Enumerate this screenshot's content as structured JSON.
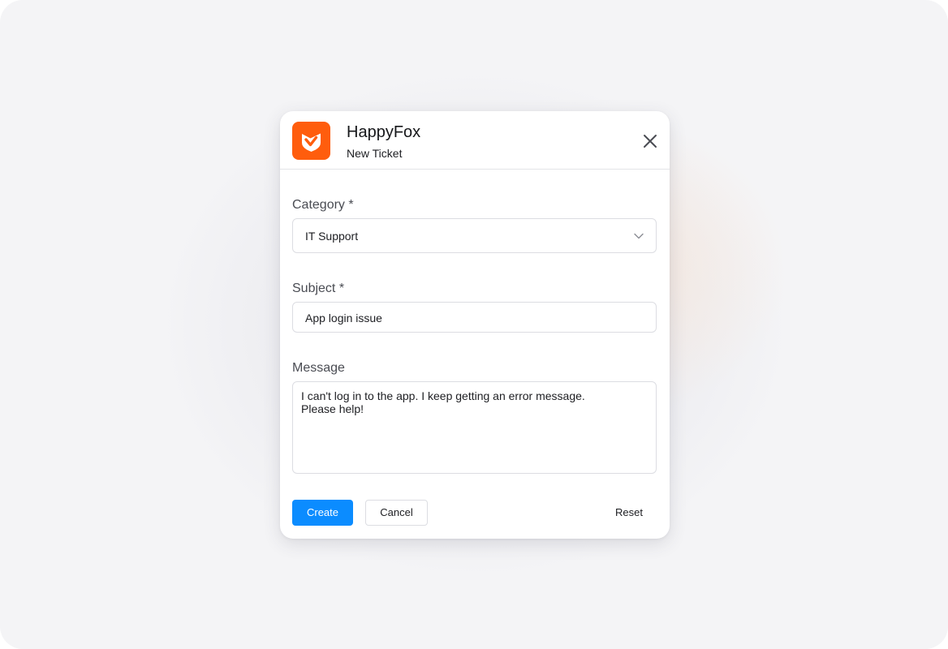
{
  "app": {
    "name": "HappyFox",
    "subtitle": "New Ticket",
    "brand_color": "#ff5d0d",
    "logo_icon": "happyfox-logo-icon",
    "close_icon": "close-icon"
  },
  "form": {
    "category": {
      "label": "Category *",
      "value": "IT Support",
      "icon": "chevron-down-icon"
    },
    "subject": {
      "label": "Subject *",
      "value": "App login issue"
    },
    "message": {
      "label": "Message",
      "value": "I can't log in to the app. I keep getting an error message.\nPlease help!"
    }
  },
  "actions": {
    "create_label": "Create",
    "cancel_label": "Cancel",
    "reset_label": "Reset",
    "primary_color": "#0b8cff"
  }
}
